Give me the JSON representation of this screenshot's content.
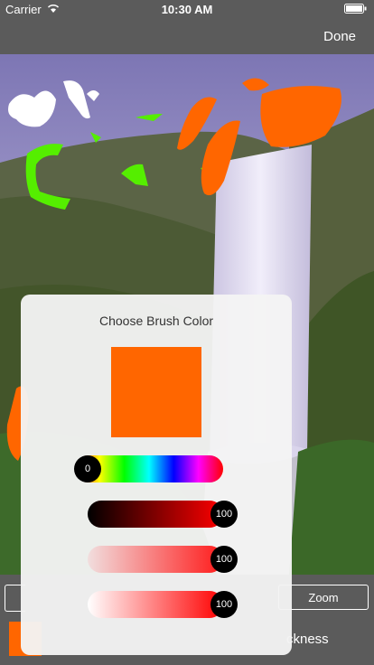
{
  "status_bar": {
    "carrier": "Carrier",
    "time": "10:30 AM",
    "wifi_icon": "wifi-icon",
    "battery_icon": "battery-icon"
  },
  "nav": {
    "done_label": "Done"
  },
  "toolbar": {
    "zoom_label": "Zoom",
    "thickness_label": "ckness"
  },
  "popup": {
    "title": "Choose Brush Color",
    "selected_color": "#ff6600",
    "sliders": [
      {
        "name": "hue",
        "value": "0"
      },
      {
        "name": "brightness",
        "value": "100"
      },
      {
        "name": "saturation",
        "value": "100"
      },
      {
        "name": "alpha",
        "value": "100"
      }
    ]
  },
  "colors": {
    "brush_orange": "#ff6600",
    "brush_green": "#55ee00",
    "brush_white": "#ffffff",
    "bar_gray": "#5b5b5b"
  }
}
